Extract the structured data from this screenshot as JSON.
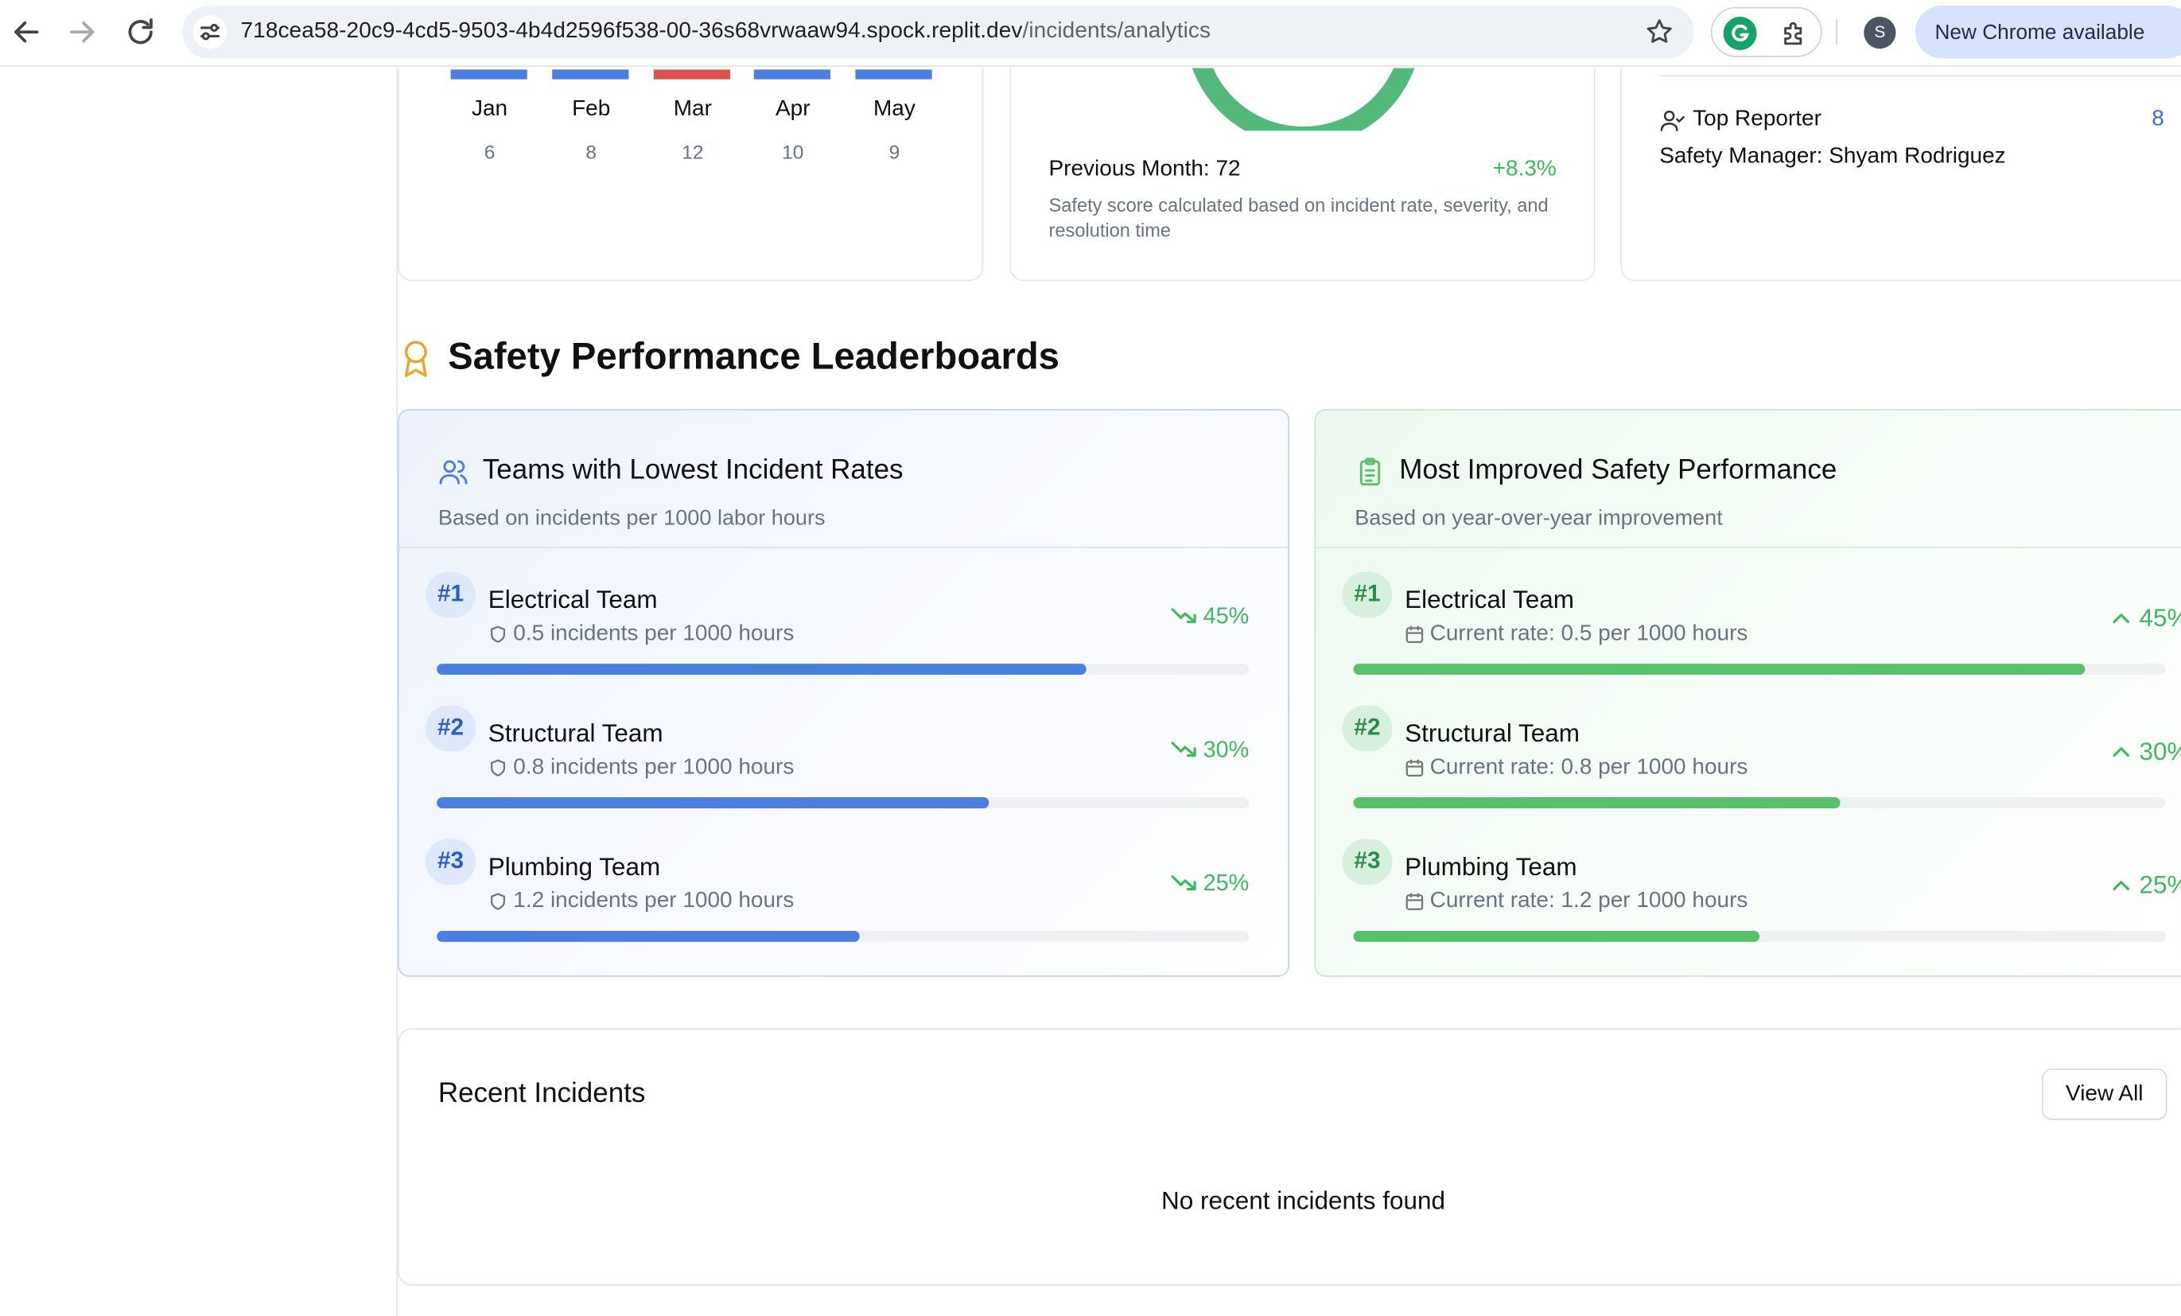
{
  "browser": {
    "url_host": "718cea58-20c9-4cd5-9503-4b4d2596f538-00-36s68vrwaaw94.spock.replit.dev",
    "url_path": "/incidents/analytics",
    "profile_initial": "S",
    "update_label": "New Chrome available"
  },
  "monthly_chart": {
    "months": [
      {
        "label": "Jan",
        "value": "6",
        "color": "#4a7fe0"
      },
      {
        "label": "Feb",
        "value": "8",
        "color": "#4a7fe0"
      },
      {
        "label": "Mar",
        "value": "12",
        "color": "#d9534f"
      },
      {
        "label": "Apr",
        "value": "10",
        "color": "#4a7fe0"
      },
      {
        "label": "May",
        "value": "9",
        "color": "#4a7fe0"
      }
    ]
  },
  "safety_score": {
    "previous_month": "Previous Month: 72",
    "change": "+8.3%",
    "note": "Safety score calculated based on incident rate, severity, and resolution time",
    "ring_color": "#52b97a"
  },
  "reporter": {
    "label": "Top Reporter",
    "count": "8",
    "name": "Safety Manager: Shyam Rodriguez"
  },
  "leaderboards": {
    "title": "Safety Performance Leaderboards",
    "lowest": {
      "title": "Teams with Lowest Incident Rates",
      "subtitle": "Based on incidents per 1000 labor hours",
      "accent": "#4a7fe0",
      "trend_color": "#3fb85f",
      "teams": [
        {
          "rank": "#1",
          "name": "Electrical Team",
          "detail": "0.5 incidents per 1000 hours",
          "change": "45%",
          "progress": 0.8
        },
        {
          "rank": "#2",
          "name": "Structural Team",
          "detail": "0.8 incidents per 1000 hours",
          "change": "30%",
          "progress": 0.68
        },
        {
          "rank": "#3",
          "name": "Plumbing Team",
          "detail": "1.2 incidents per 1000 hours",
          "change": "25%",
          "progress": 0.52
        }
      ]
    },
    "improved": {
      "title": "Most Improved Safety Performance",
      "subtitle": "Based on year-over-year improvement",
      "accent": "#58c06a",
      "trend_color": "#3fb85f",
      "teams": [
        {
          "rank": "#1",
          "name": "Electrical Team",
          "detail": "Current rate: 0.5 per 1000 hours",
          "change": "45%",
          "progress": 0.9
        },
        {
          "rank": "#2",
          "name": "Structural Team",
          "detail": "Current rate: 0.8 per 1000 hours",
          "change": "30%",
          "progress": 0.6
        },
        {
          "rank": "#3",
          "name": "Plumbing Team",
          "detail": "Current rate: 1.2 per 1000 hours",
          "change": "25%",
          "progress": 0.5
        }
      ]
    }
  },
  "recent": {
    "title": "Recent Incidents",
    "view_all": "View All",
    "empty": "No recent incidents found"
  }
}
